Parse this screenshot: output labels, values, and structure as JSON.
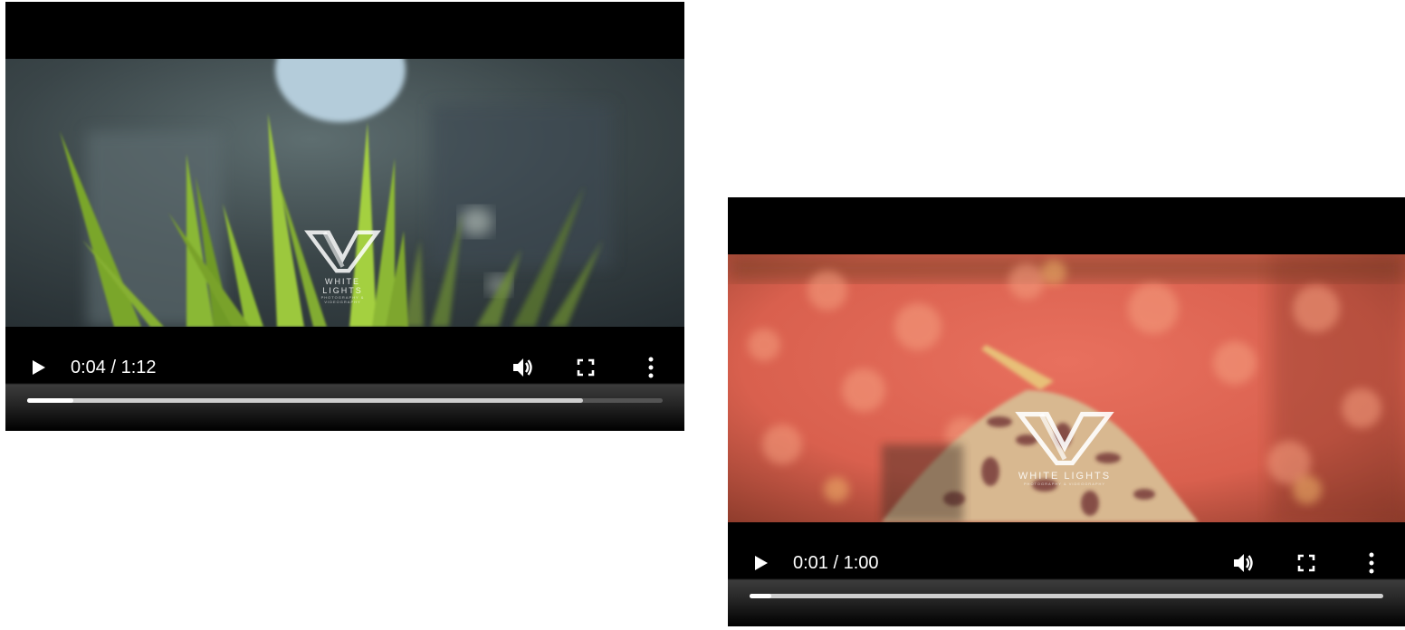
{
  "players": [
    {
      "current_time": "0:04",
      "duration": "1:12",
      "time_label": "0:04 / 1:12",
      "played_fraction": 0.072,
      "buffered_fraction": 0.875,
      "watermark": {
        "name": "WHITE LIGHTS",
        "tagline": "PHOTOGRAPHY & VIDEOGRAPHY"
      }
    },
    {
      "current_time": "0:01",
      "duration": "1:00",
      "time_label": "0:01 / 1:00",
      "played_fraction": 0.034,
      "buffered_fraction": 1.0,
      "watermark": {
        "name": "WHITE LIGHTS",
        "tagline": "PHOTOGRAPHY & VIDEOGRAPHY"
      }
    }
  ],
  "icons": {
    "play": "play-icon",
    "volume": "volume-icon",
    "fullscreen": "fullscreen-icon",
    "more": "more-options-icon"
  },
  "colors": {
    "player_background": "#000000",
    "progress_played": "#ffffff",
    "progress_buffered": "#cfcfcf",
    "progress_track": "#545454"
  }
}
